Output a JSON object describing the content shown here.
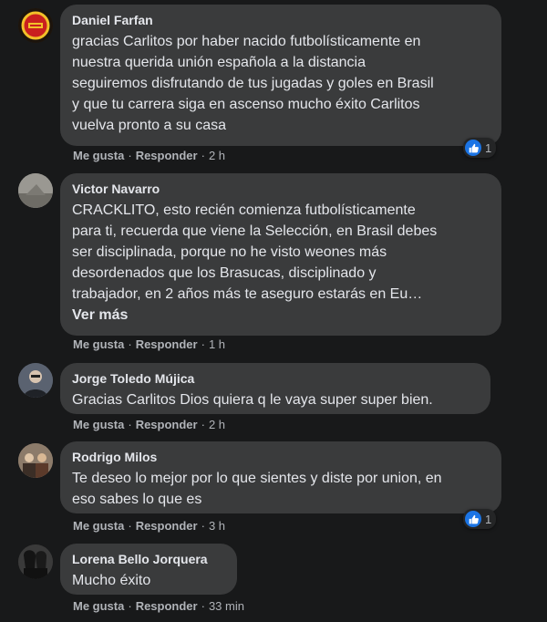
{
  "comments": [
    {
      "author": "Daniel Farfan",
      "lines": [
        "gracias Carlitos por haber nacido futbolísticamente en",
        "nuestra querida unión española a la distancia",
        "seguiremos disfrutando de tus jugadas y goles en Brasil",
        "y que tu carrera siga en ascenso mucho éxito Carlitos",
        "vuelva pronto a su casa"
      ],
      "like_label": "Me gusta",
      "reply_label": "Responder",
      "time": "2 h",
      "reaction_count": "1"
    },
    {
      "author": "Victor Navarro",
      "lines": [
        "CRACKLITO, esto recién comienza futbolísticamente",
        "para ti, recuerda que viene la Selección, en Brasil debes",
        "ser disciplinada, porque no he visto weones más",
        "desordenados que los Brasucas, disciplinado y",
        "trabajador, en 2 años más te aseguro estarás en Eu…"
      ],
      "see_more": "Ver más",
      "like_label": "Me gusta",
      "reply_label": "Responder",
      "time": "1 h"
    },
    {
      "author": "Jorge Toledo Mújica",
      "lines": [
        "Gracias Carlitos Dios quiera q le vaya super super bien."
      ],
      "like_label": "Me gusta",
      "reply_label": "Responder",
      "time": "2 h"
    },
    {
      "author": "Rodrigo Milos",
      "lines": [
        "Te deseo lo mejor por lo que sientes y diste por union, en",
        "eso sabes lo que es"
      ],
      "like_label": "Me gusta",
      "reply_label": "Responder",
      "time": "3 h",
      "reaction_count": "1"
    },
    {
      "author": "Lorena Bello Jorquera",
      "lines": [
        "Mucho éxito"
      ],
      "like_label": "Me gusta",
      "reply_label": "Responder",
      "time": "33 min"
    }
  ],
  "colors": {
    "background": "#18191a",
    "bubble": "#3a3b3c",
    "text": "#e4e6eb",
    "secondary_text": "#b0b3b8",
    "like_blue": "#1b74e4"
  }
}
